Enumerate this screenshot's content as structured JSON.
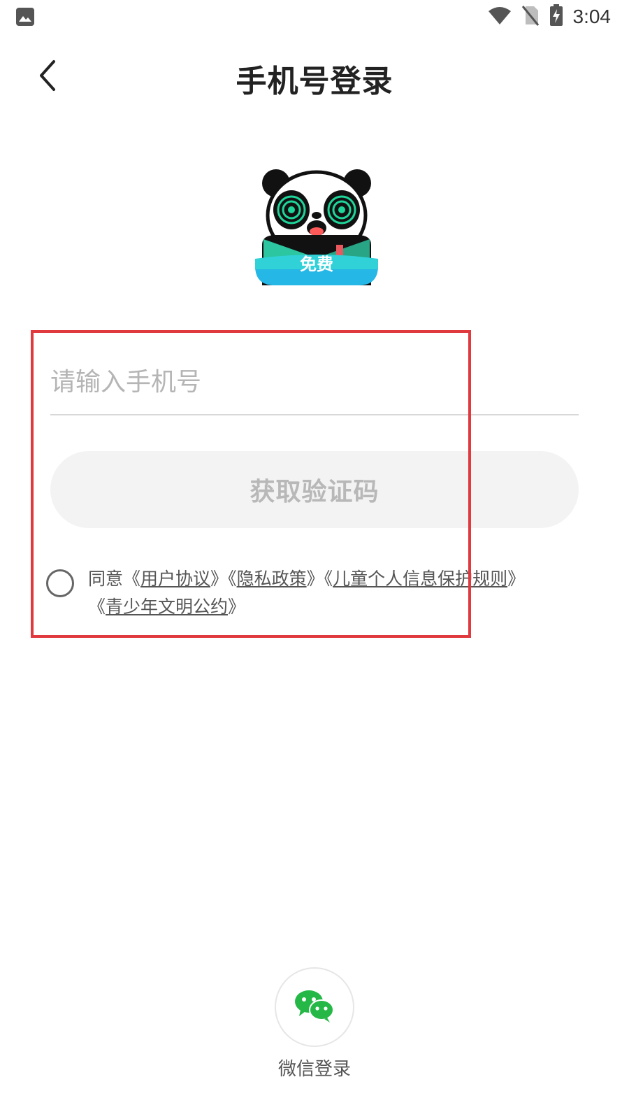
{
  "status_bar": {
    "time": "3:04",
    "left_icon": "gallery-icon",
    "right_icons": [
      "wifi-icon",
      "no-sim-icon",
      "battery-charging-icon"
    ]
  },
  "header": {
    "title": "手机号登录",
    "back_icon": "chevron-left-icon"
  },
  "logo": {
    "badge_text": "免费"
  },
  "form": {
    "phone_placeholder": "请输入手机号",
    "phone_value": "",
    "get_code_label": "获取验证码"
  },
  "agreement": {
    "prefix": "同意",
    "links": [
      "用户协议",
      "隐私政策",
      "儿童个人信息保护规则",
      "青少年文明公约"
    ],
    "checked": false
  },
  "wechat": {
    "label": "微信登录",
    "icon": "wechat-icon",
    "color": "#25b847"
  },
  "colors": {
    "highlight": "#e0393e",
    "button_bg": "#f3f3f3",
    "button_text": "#b8b8b8"
  }
}
